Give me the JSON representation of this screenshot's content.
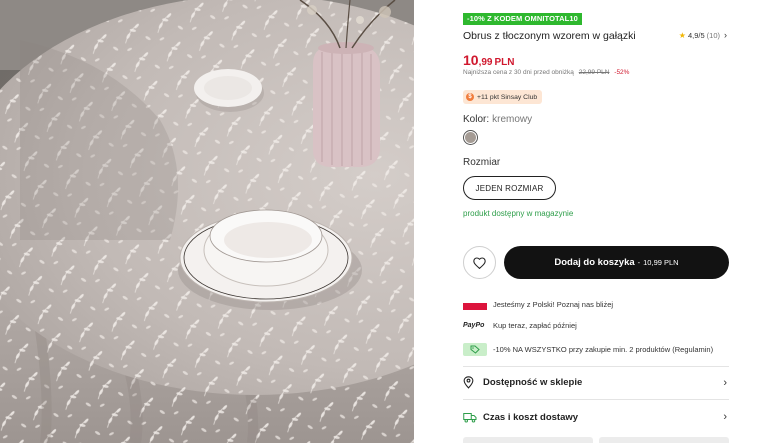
{
  "product": {
    "promo_badge": "-10% Z KODEM OMNITOTAL10",
    "title": "Obrus z tłoczonym wzorem w gałązki",
    "rating": {
      "star_icon": "star-icon",
      "score": "4,9/5",
      "count": "(10)"
    },
    "price": {
      "integer": "10",
      "decimals": ",99",
      "currency": "PLN"
    },
    "lowest_price": {
      "text": "Najniższa cena z 30 dni przed obniżką",
      "old_price": "22,99 PLN",
      "discount": "-52%"
    },
    "club_badge": "+11 pkt Sinsay Club"
  },
  "color": {
    "label": "Kolor:",
    "value": "kremowy",
    "swatch": "#a59c95"
  },
  "size": {
    "label": "Rozmiar",
    "option": "JEDEN ROZMIAR"
  },
  "stock_status": "produkt dostępny w magazynie",
  "actions": {
    "wishlist_icon": "heart-icon",
    "add_to_cart": "Dodaj do koszyka",
    "separator": "-",
    "cart_price": "10,99 PLN"
  },
  "info": [
    {
      "icon": "poland-flag-icon",
      "text": "Jesteśmy z Polski! Poznaj nas bliżej"
    },
    {
      "icon": "paypo-logo",
      "logo": "PayPo",
      "text": "Kup teraz, zapłać później"
    },
    {
      "icon": "tag-icon",
      "text": "-10% NA WSZYSTKO przy zakupie min. 2 produktów (Regulamin)"
    }
  ],
  "accordions": [
    {
      "icon": "location-pin-icon",
      "label": "Dostępność w sklepie"
    },
    {
      "icon": "truck-icon",
      "label": "Czas i koszt dostawy"
    }
  ],
  "colors": {
    "accent_green": "#2eb82e",
    "price_red": "#d0182e",
    "button_dark": "#121212"
  }
}
